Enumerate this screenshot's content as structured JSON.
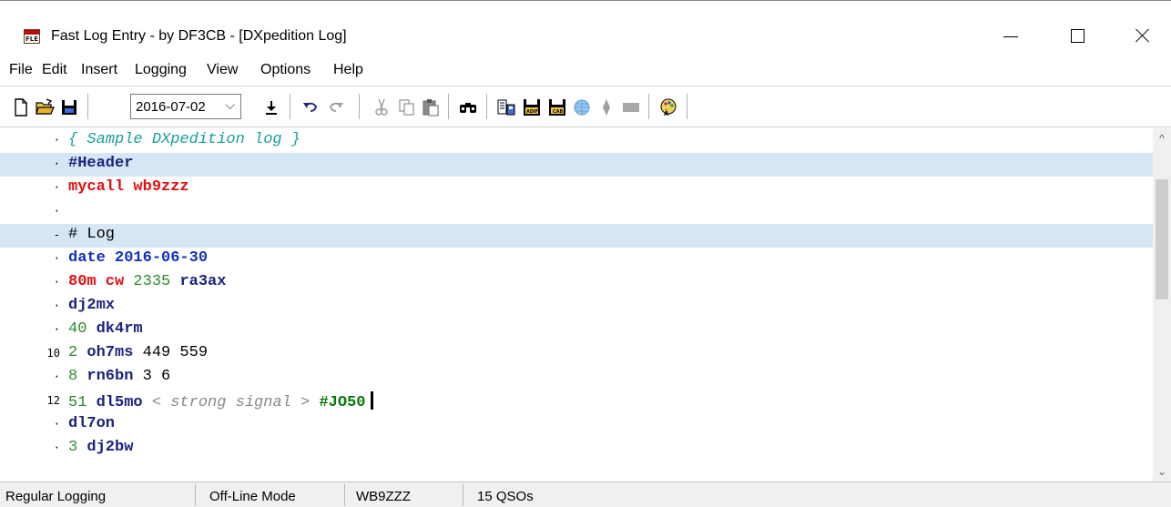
{
  "window": {
    "title": "Fast Log Entry - by DF3CB - [DXpedition Log]",
    "app_icon_text": "FLE"
  },
  "menu": [
    "File",
    "Edit",
    "Insert",
    "Logging",
    "View",
    "Options",
    "Help"
  ],
  "toolbar": {
    "date_value": "2016-07-02",
    "icons": [
      "new-file-icon",
      "open-folder-icon",
      "save-icon",
      "download-icon",
      "undo-icon",
      "redo-icon",
      "cut-icon",
      "copy-icon",
      "paste-icon",
      "find-icon",
      "export-icon",
      "adif-export-icon",
      "cabrillo-export-icon",
      "globe-icon",
      "map-icon",
      "grid-icon",
      "palette-icon"
    ]
  },
  "editor": {
    "lines": [
      {
        "gutter": "·",
        "tokens": [
          {
            "t": "{ Sample DXpedition log }",
            "c": "c-comment"
          }
        ]
      },
      {
        "gutter": "·",
        "highlight": true,
        "tokens": [
          {
            "t": "#Header",
            "c": "c-hdr"
          }
        ]
      },
      {
        "gutter": "·",
        "tokens": [
          {
            "t": "mycall wb9zzz",
            "c": "c-kw"
          }
        ]
      },
      {
        "gutter": "·",
        "tokens": []
      },
      {
        "gutter": "-",
        "highlight": true,
        "tokens": [
          {
            "t": "# Log",
            "c": "c-num"
          }
        ]
      },
      {
        "gutter": "·",
        "tokens": [
          {
            "t": "date 2016-06-30",
            "c": "c-blue"
          }
        ]
      },
      {
        "gutter": "·",
        "tokens": [
          {
            "t": "80m cw ",
            "c": "c-kw"
          },
          {
            "t": "2335 ",
            "c": "c-green"
          },
          {
            "t": "ra3ax",
            "c": "c-call"
          }
        ]
      },
      {
        "gutter": "·",
        "tokens": [
          {
            "t": "dj2mx",
            "c": "c-call"
          }
        ]
      },
      {
        "gutter": "·",
        "tokens": [
          {
            "t": "40 ",
            "c": "c-green"
          },
          {
            "t": "dk4rm",
            "c": "c-call"
          }
        ]
      },
      {
        "gutter": "10",
        "tokens": [
          {
            "t": "2 ",
            "c": "c-green"
          },
          {
            "t": "oh7ms ",
            "c": "c-call"
          },
          {
            "t": "449 559",
            "c": "c-num"
          }
        ]
      },
      {
        "gutter": "·",
        "tokens": [
          {
            "t": "8 ",
            "c": "c-green"
          },
          {
            "t": "rn6bn ",
            "c": "c-call"
          },
          {
            "t": "3 6",
            "c": "c-num"
          }
        ]
      },
      {
        "gutter": "12",
        "cursor": true,
        "tokens": [
          {
            "t": "51 ",
            "c": "c-green"
          },
          {
            "t": "dl5mo ",
            "c": "c-call"
          },
          {
            "t": "< strong signal > ",
            "c": "c-remark"
          },
          {
            "t": "#JO50",
            "c": "c-loc"
          }
        ]
      },
      {
        "gutter": "·",
        "tokens": [
          {
            "t": "dl7on",
            "c": "c-call"
          }
        ]
      },
      {
        "gutter": "·",
        "tokens": [
          {
            "t": "3 ",
            "c": "c-green"
          },
          {
            "t": "dj2bw",
            "c": "c-call"
          }
        ]
      }
    ]
  },
  "statusbar": {
    "mode": "Regular Logging",
    "connection": "Off-Line Mode",
    "callsign": "WB9ZZZ",
    "qso_count": "15 QSOs"
  }
}
